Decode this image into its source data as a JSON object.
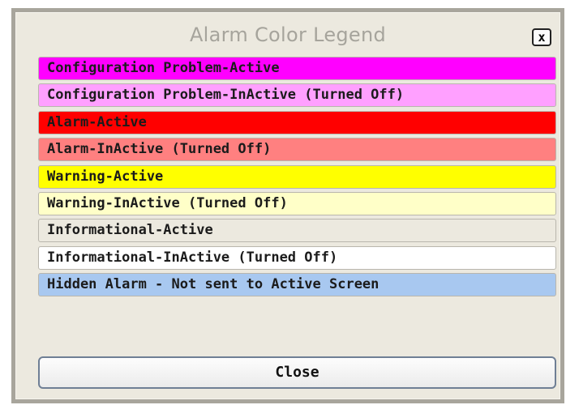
{
  "dialog": {
    "title": "Alarm Color Legend",
    "close_x_label": "x",
    "close_button_label": "Close"
  },
  "legend": [
    {
      "label": "Configuration Problem-Active",
      "color": "#ff00ff"
    },
    {
      "label": "Configuration Problem-InActive (Turned Off)",
      "color": "#ffa0ff"
    },
    {
      "label": "Alarm-Active",
      "color": "#ff0000"
    },
    {
      "label": "Alarm-InActive (Turned Off)",
      "color": "#ff8080"
    },
    {
      "label": "Warning-Active",
      "color": "#ffff00"
    },
    {
      "label": "Warning-InActive (Turned Off)",
      "color": "#ffffc8"
    },
    {
      "label": "Informational-Active",
      "color": "#ece9df"
    },
    {
      "label": "Informational-InActive (Turned Off)",
      "color": "#ffffff"
    },
    {
      "label": "Hidden Alarm - Not sent to Active Screen",
      "color": "#a8c8f0"
    }
  ]
}
